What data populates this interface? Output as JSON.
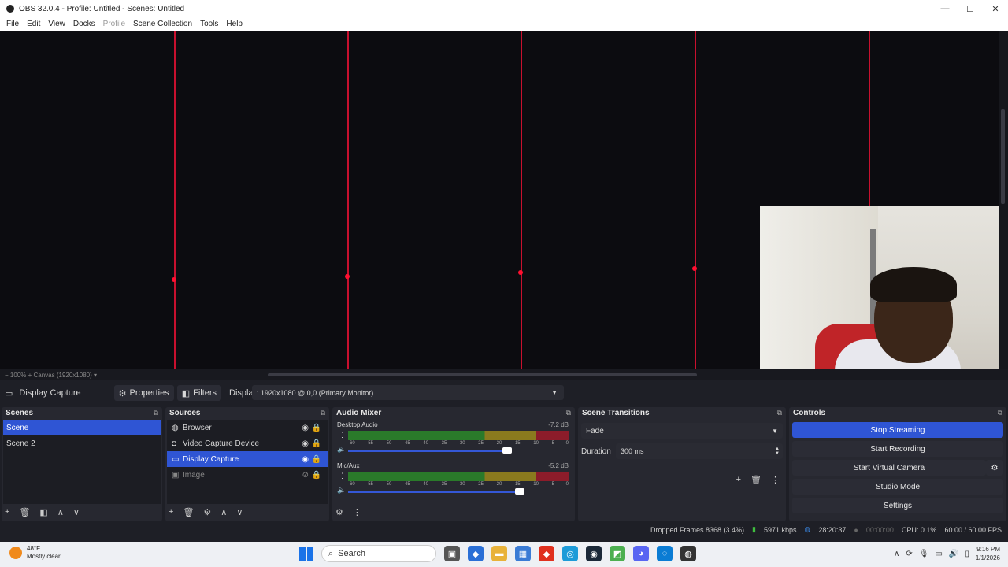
{
  "window": {
    "title": "OBS 32.0.4 - Profile: Untitled - Scenes: Untitled",
    "minimize": "—",
    "maximize": "☐",
    "close": "✕"
  },
  "menu": [
    "File",
    "Edit",
    "View",
    "Docks",
    "Profile",
    "Scene Collection",
    "Tools",
    "Help"
  ],
  "preview": {
    "zoom": "100%",
    "canvas": "Canvas (1920x1080)"
  },
  "context_bar": {
    "source_name": "Display Capture",
    "properties": "Properties",
    "filters": "Filters",
    "display_label": "Display",
    "display_value": ": 1920x1080 @ 0,0 (Primary Monitor)"
  },
  "scenes": {
    "title": "Scenes",
    "items": [
      "Scene",
      "Scene 2"
    ],
    "selected": "Scene"
  },
  "sources": {
    "title": "Sources",
    "items": [
      {
        "name": "Browser",
        "icon": "globe-icon"
      },
      {
        "name": "Video Capture Device",
        "icon": "camera-icon"
      },
      {
        "name": "Display Capture",
        "icon": "monitor-icon"
      },
      {
        "name": "Image",
        "icon": "image-icon"
      }
    ]
  },
  "audio_mixer": {
    "title": "Audio Mixer",
    "channels": [
      {
        "name": "Desktop Audio",
        "db": "-7.2 dB",
        "volume": 0.72
      },
      {
        "name": "Mic/Aux",
        "db": "-5.2 dB",
        "volume": 0.78
      }
    ],
    "ticks": [
      "-60",
      "-55",
      "-50",
      "-45",
      "-40",
      "-35",
      "-30",
      "-25",
      "-20",
      "-15",
      "-10",
      "-5",
      "0"
    ]
  },
  "transitions": {
    "title": "Scene Transitions",
    "type": "Fade",
    "duration_label": "Duration",
    "duration_value": "300 ms"
  },
  "controls": {
    "title": "Controls",
    "stop_streaming": "Stop Streaming",
    "start_recording": "Start Recording",
    "start_virtual_camera": "Start Virtual Camera",
    "studio_mode": "Studio Mode",
    "settings": "Settings"
  },
  "status": {
    "dropped_frames": "Dropped Frames 8368 (3.4%)",
    "bitrate": "5971 kbps",
    "stream_time": "28:20:37",
    "rec_time": "00:00:00",
    "cpu": "CPU: 0.1%",
    "fps": "60.00 / 60.00 FPS"
  },
  "taskbar": {
    "temp": "48°F",
    "weather": "Mostly clear",
    "search": "Search",
    "time": "9:16 PM",
    "date": "1/1/2026"
  },
  "colors": {
    "accent": "#2f55d4",
    "redline": "#c8102e",
    "bg": "#1e1f26"
  }
}
